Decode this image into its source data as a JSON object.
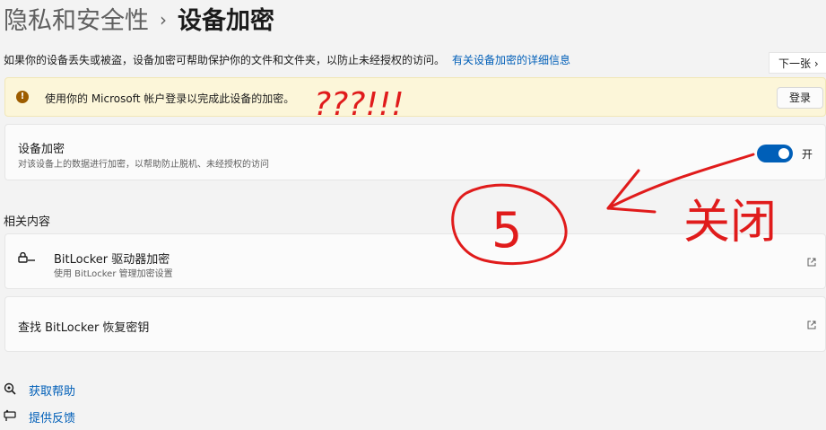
{
  "header": {
    "breadcrumb_parent": "隐私和安全性",
    "separator": "›",
    "title": "设备加密"
  },
  "description": {
    "text": "如果你的设备丢失或被盗，设备加密可帮助保护你的文件和文件夹，以防止未经授权的访问。",
    "link": "有关设备加密的详细信息"
  },
  "next_button": {
    "label": "下一张 ›"
  },
  "banner": {
    "icon": "warning-icon",
    "message": "使用你的 Microsoft 帐户登录以完成此设备的加密。",
    "button": "登录"
  },
  "encryption": {
    "title": "设备加密",
    "subtitle": "对该设备上的数据进行加密，以帮助防止脱机、未经授权的访问",
    "toggle_label": "开",
    "toggle_on": true
  },
  "related": {
    "heading": "相关内容",
    "items": [
      {
        "title": "BitLocker 驱动器加密",
        "subtitle": "使用 BitLocker 管理加密设置",
        "icon": "bitlocker-key-icon"
      },
      {
        "title": "查找 BitLocker 恢复密钥",
        "icon": "external-link-icon"
      }
    ]
  },
  "help": [
    {
      "label": "获取帮助",
      "icon": "help-icon"
    },
    {
      "label": "提供反馈",
      "icon": "feedback-icon"
    }
  ],
  "annotations": {
    "text_question": "???!!!",
    "circled_number": "5",
    "text_close": "关闭",
    "color": "#e01b1b"
  },
  "colors": {
    "accent": "#005fb8",
    "banner_bg": "#fcf6d9",
    "annotation": "#e01b1b"
  }
}
